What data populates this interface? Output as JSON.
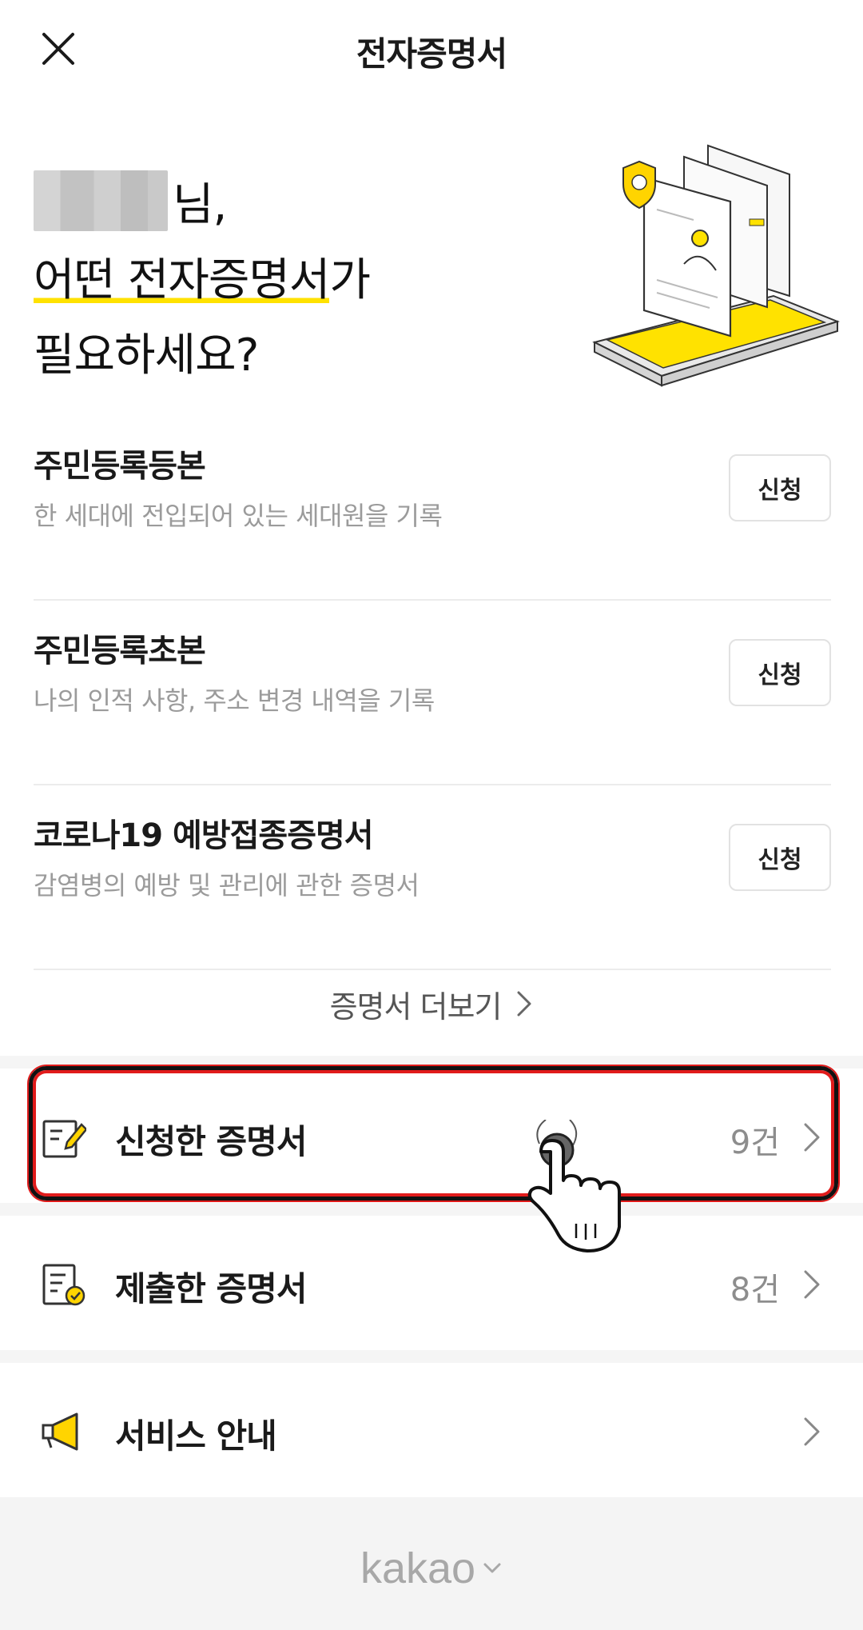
{
  "header": {
    "title": "전자증명서"
  },
  "hero": {
    "greeting_suffix": "님,",
    "line2_highlight": "어떤 전자증명서",
    "line2_rest": "가",
    "line3": "필요하세요?"
  },
  "certificates": [
    {
      "name": "주민등록등본",
      "desc": "한 세대에 전입되어 있는 세대원을 기록",
      "button": "신청"
    },
    {
      "name": "주민등록초본",
      "desc": "나의 인적 사항, 주소 변경 내역을 기록",
      "button": "신청"
    },
    {
      "name": "코로나19 예방접종증명서",
      "desc": "감염병의 예방 및 관리에 관한 증명서",
      "button": "신청"
    }
  ],
  "more": {
    "label": "증명서 더보기"
  },
  "menu": [
    {
      "label": "신청한 증명서",
      "count": "9건",
      "icon": "edit-document-icon"
    },
    {
      "label": "제출한 증명서",
      "count": "8건",
      "icon": "checked-document-icon"
    },
    {
      "label": "서비스 안내",
      "count": "",
      "icon": "megaphone-icon"
    }
  ],
  "footer": {
    "brand": "kakao"
  },
  "colors": {
    "accent_yellow": "#FFE200",
    "highlight_red": "#E11B1B"
  }
}
